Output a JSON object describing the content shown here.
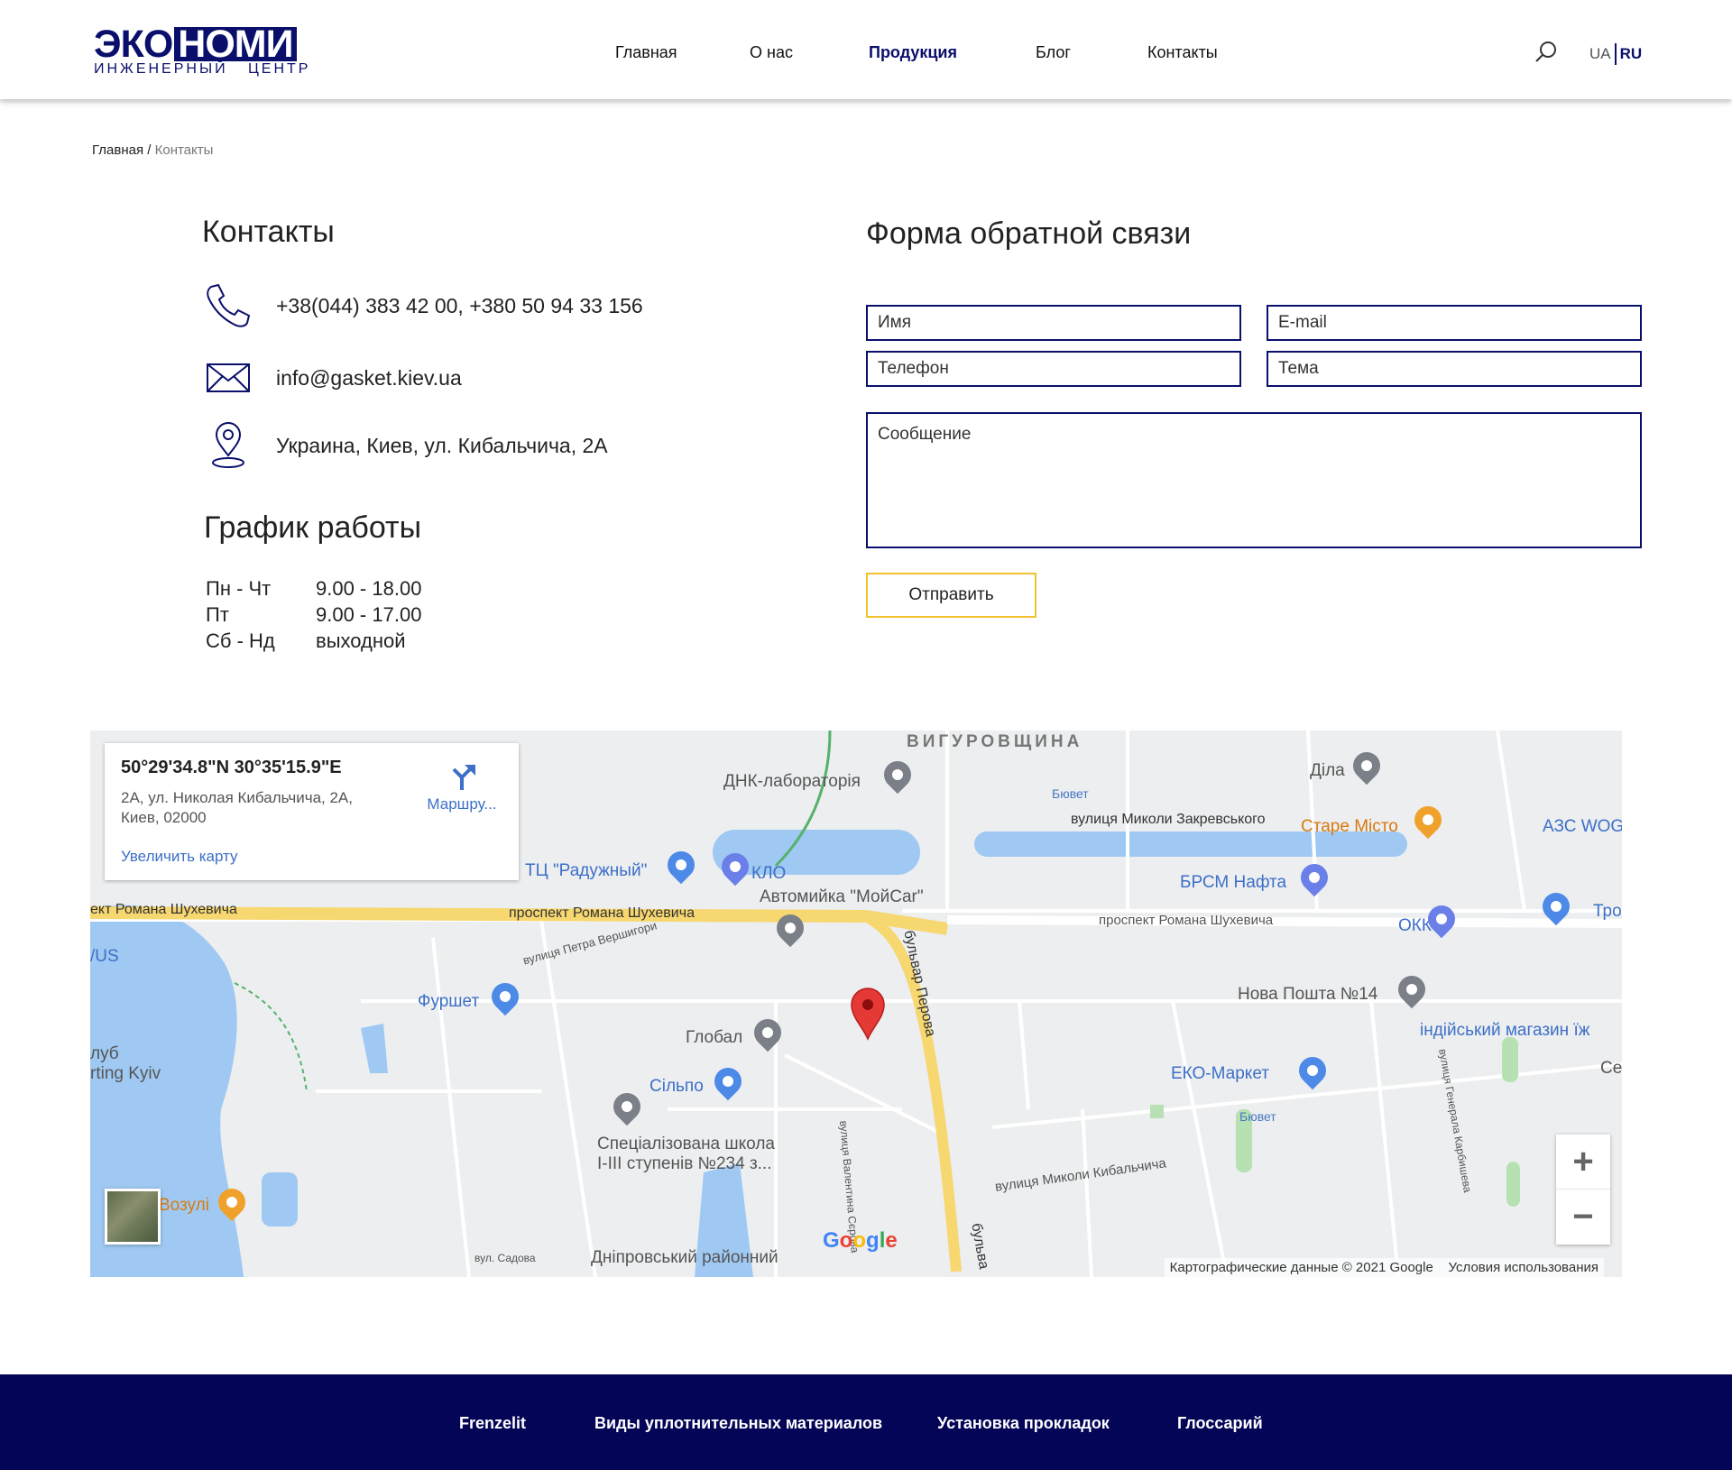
{
  "header": {
    "logo": {
      "top_left": "ЭКО",
      "top_right": "НОМИ",
      "subtitle": "ИНЖЕНЕРНЫЙ   ЦЕНТР"
    },
    "nav": [
      "Главная",
      "О нас",
      "Продукция",
      "Блог",
      "Контакты"
    ],
    "active_nav": "Продукция",
    "search_icon": "search-icon",
    "lang": {
      "ua": "UA",
      "ru": "RU",
      "active": "RU"
    }
  },
  "breadcrumb": {
    "home": "Главная",
    "separator": " / ",
    "current": "Контакты"
  },
  "contacts": {
    "title": "Контакты",
    "phone": "+38(044) 383 42 00, +380 50 94 33 156",
    "email": "info@gasket.kiev.ua",
    "address": "Украина, Киев, ул. Кибальчича, 2А",
    "icons": [
      "phone-icon",
      "envelope-icon",
      "location-pin-icon"
    ]
  },
  "schedule": {
    "title": "График работы",
    "rows": [
      {
        "days": "Пн - Чт",
        "hours": "9.00 - 18.00"
      },
      {
        "days": "Пт",
        "hours": "9.00 - 17.00"
      },
      {
        "days": "Сб - Нд",
        "hours": "выходной"
      }
    ]
  },
  "form": {
    "title": "Форма обратной связи",
    "name_placeholder": "Имя",
    "email_placeholder": "E-mail",
    "phone_placeholder": "Телефон",
    "subject_placeholder": "Тема",
    "message_placeholder": "Сообщение",
    "submit_label": "Отправить",
    "accent": "#f2c12e"
  },
  "map": {
    "infobox": {
      "coords": "50°29'34.8\"N 30°35'15.9\"E",
      "address": "2А, ул. Николая Кибальчича, 2А, Киев, 02000",
      "directions": "Маршру...",
      "enlarge": "Увеличить карту"
    },
    "labels": {
      "district": "ВИГУРОВЩИНА",
      "dnk": "ДНК-лабораторія",
      "dila": "Діла",
      "biuvet1": "Бювет",
      "zakrevskoho": "вулиця Миколи Закревського",
      "stare_misto": "Старе Місто",
      "azs": "АЗС WOG",
      "raduzhny": "ТЦ \"Радужный\"",
      "klo": "КЛО",
      "moycar": "Автомийка \"МойCar\"",
      "brsm": "БРСМ Нафта",
      "troe": "Троєщ",
      "okko": "ОККО",
      "shukhevycha_l": "ект Романа Шухевича",
      "shukhevycha_m": "проспект Романа Шухевича",
      "shukhevycha_r": "проспект Романа Шухевича",
      "vershyhory": "вулиця Петра Вершигори",
      "perova": "бульвар Перова",
      "vus": "/US",
      "furshet": "Фуршет",
      "nova_poshta": "Нова Пошта №14",
      "indian": "індійський магазин їж",
      "global": "Глобал",
      "club": "луб",
      "sporting": "rting Kyiv",
      "silpo": "Сільпо",
      "eko": "ЕКО-Маркет",
      "se": "Се",
      "biuvet2": "Бювет",
      "school1": "Спеціалізована школа",
      "school2": "I-III ступенів №234 з...",
      "kybalchycha": "вулиця Миколи Кибальчича",
      "valentyna": "вулиця Валентина Сєрова",
      "karbysheva": "вулиця Генерала Карбишева",
      "vozuli": "Возулі",
      "sadova": "вул. Садова",
      "dnipro": "Дніпровський районний",
      "bulva": "бульва",
      "google": "Google"
    },
    "attribution": "Картографические данные © 2021 Google",
    "terms": "Условия использования",
    "zoom_in": "+",
    "zoom_out": "−"
  },
  "footer": {
    "links": [
      "Frenzelit",
      "Виды уплотнительных материалов",
      "Установка прокладок",
      "Глоссарий"
    ],
    "bg": "#050558"
  }
}
